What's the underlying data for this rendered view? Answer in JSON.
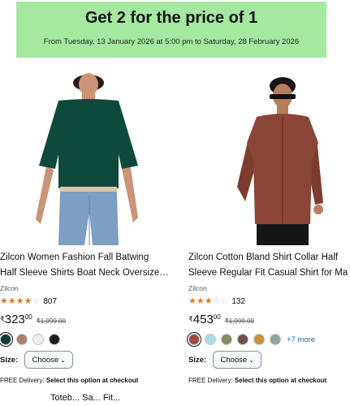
{
  "promo": {
    "title": "Get 2 for the price of 1",
    "dates": "From Tuesday, 13 January 2026 at 5:00 pm to Saturday, 28 February 2026",
    "background": "#a5e8a0"
  },
  "products": [
    {
      "title_line1": "Zilcon Women Fashion Fall Batwing",
      "title_line2": "Half Sleeve Shirts Boat Neck Oversize…",
      "brand": "Zilcon",
      "rating": 3.5,
      "rating_count": "807",
      "currency": "₹",
      "price_whole": "323",
      "price_fraction": "00",
      "price_old": "₹1,999.00",
      "swatches": [
        "#0e3e36",
        "#b07e6e",
        "#ececec",
        "#1d1d1d"
      ],
      "more_colors": "",
      "size_label": "Size:",
      "size_choose": "Choose",
      "delivery_prefix": "FREE Delivery: ",
      "delivery_text": "Select this option at checkout"
    },
    {
      "title_line1": "Zilcon Cotton Bland Shirt Collar Half",
      "title_line2": "Sleeve Regular Fit Casual Shirt for Ma",
      "brand": "Zilcon",
      "rating": 2.5,
      "rating_count": "132",
      "currency": "₹",
      "price_whole": "453",
      "price_fraction": "00",
      "price_old": "₹1,999.00",
      "swatches": [
        "#9c4a40",
        "#a8dde0",
        "#8a8a62",
        "#6a5448",
        "#c8913a",
        "#8fa3a0"
      ],
      "more_colors": "+7 more",
      "size_label": "Size:",
      "size_choose": "Choose",
      "delivery_prefix": "FREE Delivery: ",
      "delivery_text": "Select this option at checkout"
    }
  ],
  "footer_partial": "Toteb... Sa... Fit..."
}
